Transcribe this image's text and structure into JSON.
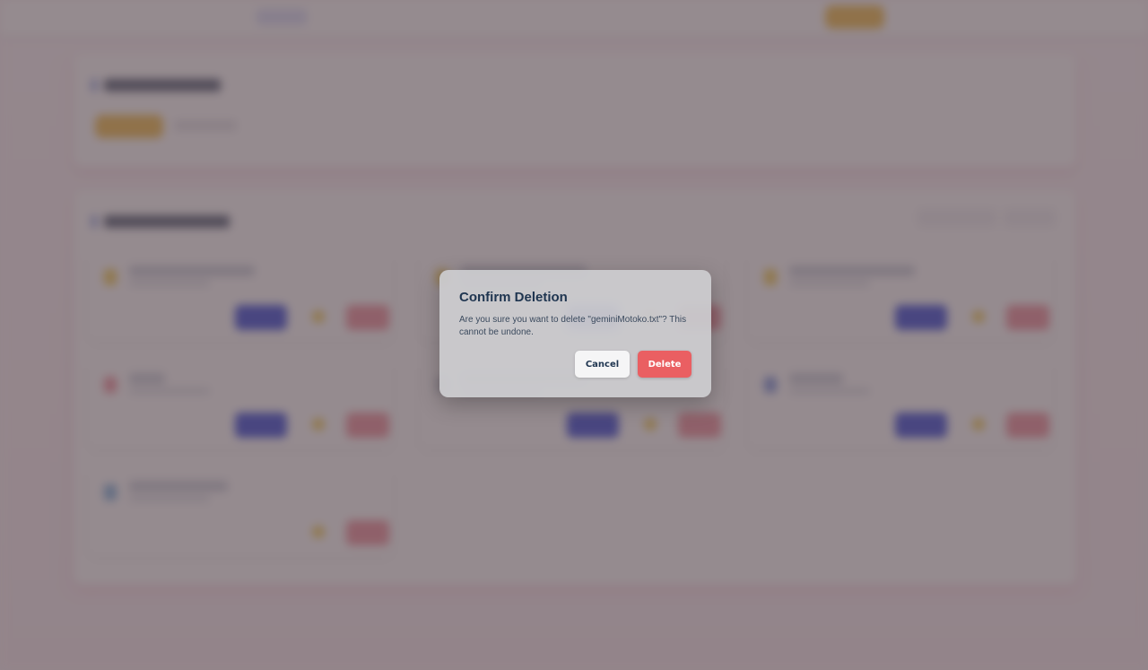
{
  "dialog": {
    "title": "Confirm Deletion",
    "message": "Are you sure you want to delete \"geminiMotoko.txt\"? This cannot be undone.",
    "cancel_label": "Cancel",
    "delete_label": "Delete"
  },
  "colors": {
    "delete_button": "#ea5f62",
    "cancel_button": "#f5f5f6",
    "title_text": "#1f3550",
    "overlay": "#48373e",
    "accent_blue": "#4a5bdc",
    "accent_yellow": "#f2c35b"
  },
  "background_cards": [
    {
      "icon": "file-icon",
      "icon_color": "#f2d266"
    },
    {
      "icon": "file-icon",
      "icon_color": "#f2d266"
    },
    {
      "icon": "file-icon",
      "icon_color": "#f2d266"
    },
    {
      "icon": "file-icon",
      "icon_color": "#f19aa6"
    },
    {
      "icon": "file-icon",
      "icon_color": "#d0d4dd"
    },
    {
      "icon": "file-icon",
      "icon_color": "#8aa0e0"
    },
    {
      "icon": "file-icon",
      "icon_color": "#8ab8e0"
    }
  ]
}
